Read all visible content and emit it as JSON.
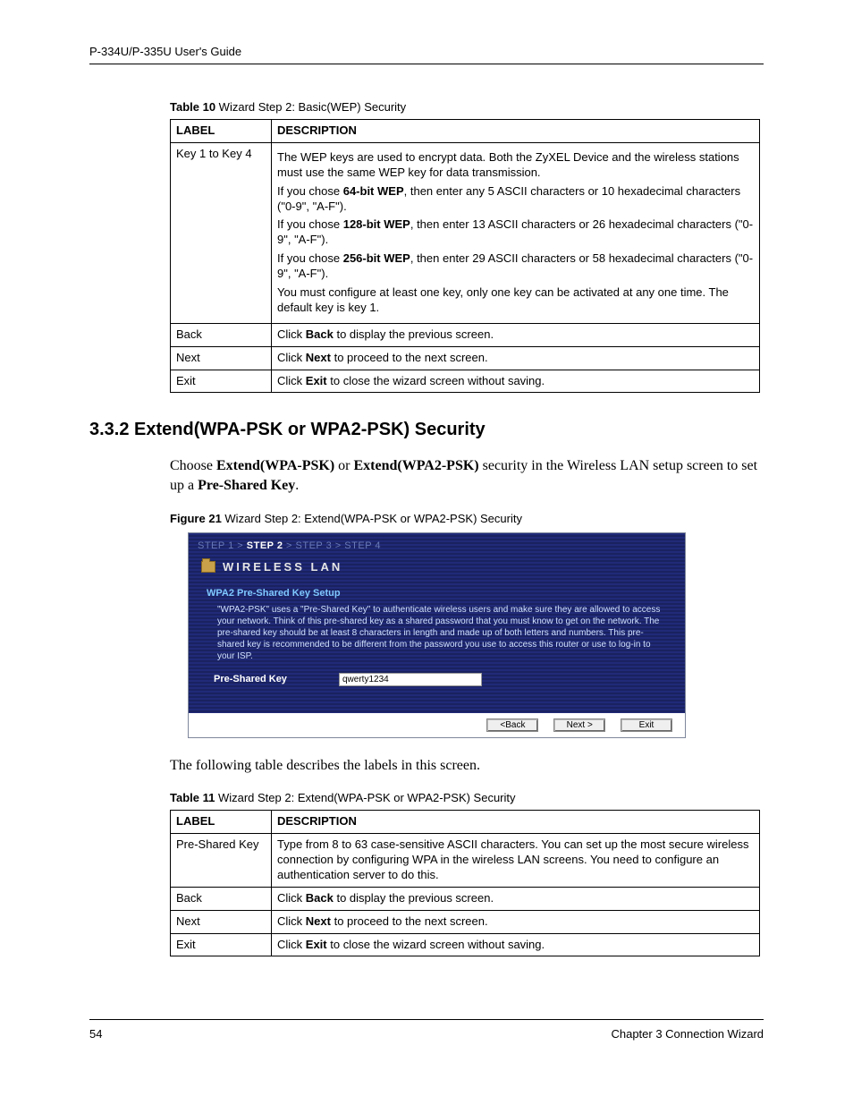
{
  "header": {
    "guide_title": "P-334U/P-335U User's Guide"
  },
  "table10": {
    "caption_prefix": "Table 10",
    "caption_rest": "   Wizard Step 2: Basic(WEP) Security",
    "col_label": "LABEL",
    "col_desc": "DESCRIPTION",
    "rows": [
      {
        "label": "Key 1 to Key 4",
        "desc_parts": {
          "p1": "The WEP keys are used to encrypt data. Both the ZyXEL Device and the wireless stations must use the same WEP key for data transmission.",
          "p2a": "If you chose ",
          "p2b": "64-bit WEP",
          "p2c": ", then enter any 5 ASCII characters or 10 hexadecimal characters (\"0-9\", \"A-F\").",
          "p3a": "If you chose ",
          "p3b": "128-bit WEP",
          "p3c": ", then enter 13 ASCII characters or 26 hexadecimal characters   (\"0-9\", \"A-F\").",
          "p4a": "If you chose ",
          "p4b": "256-bit WEP",
          "p4c": ", then enter 29 ASCII characters or 58 hexadecimal characters   (\"0-9\", \"A-F\").",
          "p5": "You must configure at least one key, only one key can be activated at any one time. The default key is key 1."
        }
      },
      {
        "label": "Back",
        "desc_parts": {
          "a": "Click ",
          "b": "Back",
          "c": " to display the previous screen."
        }
      },
      {
        "label": "Next",
        "desc_parts": {
          "a": "Click ",
          "b": "Next",
          "c": " to proceed to the next screen."
        }
      },
      {
        "label": "Exit",
        "desc_parts": {
          "a": "Click ",
          "b": "Exit",
          "c": " to close the wizard screen without saving."
        }
      }
    ]
  },
  "section_heading": "3.3.2  Extend(WPA-PSK or WPA2-PSK) Security",
  "body_para_parts": {
    "a": "Choose ",
    "b": "Extend(WPA-PSK)",
    "c": " or ",
    "d": "Extend(WPA2-PSK)",
    "e": " security in the Wireless LAN setup screen to set up a ",
    "f": "Pre-Shared Key",
    "g": "."
  },
  "figure21": {
    "caption_prefix": "Figure 21",
    "caption_rest": "   Wizard Step 2: Extend(WPA-PSK or WPA2-PSK) Security",
    "wizard": {
      "steps": {
        "s1": "STEP 1",
        "sep": " > ",
        "s2": "STEP 2",
        "s3": "STEP 3",
        "s4": "STEP 4"
      },
      "title": "WIRELESS LAN",
      "subtitle": "WPA2 Pre-Shared Key Setup",
      "desc": "\"WPA2-PSK\" uses a \"Pre-Shared Key\" to authenticate wireless users and make sure they are allowed to access your network. Think of this pre-shared key as a shared password that you must know to get on the network. The pre-shared key should be at least 8 characters in length and made up of both letters and numbers. This pre-shared key is recommended to be different from the password you use to access this router or use to log-in to your ISP.",
      "field_label": "Pre-Shared Key",
      "field_value": "qwerty1234",
      "btn_back": "<Back",
      "btn_next": "Next >",
      "btn_exit": "Exit"
    }
  },
  "body_para2": "The following table describes the labels in this screen.",
  "table11": {
    "caption_prefix": "Table 11",
    "caption_rest": "   Wizard Step 2: Extend(WPA-PSK or WPA2-PSK) Security",
    "col_label": "LABEL",
    "col_desc": "DESCRIPTION",
    "rows": [
      {
        "label": "Pre-Shared Key",
        "desc": "Type from 8 to 63 case-sensitive ASCII characters. You can set up the most secure wireless connection by configuring WPA in the wireless LAN screens. You need to configure an authentication server to do this."
      },
      {
        "label": "Back",
        "desc_parts": {
          "a": "Click ",
          "b": "Back",
          "c": " to display the previous screen."
        }
      },
      {
        "label": "Next",
        "desc_parts": {
          "a": "Click ",
          "b": "Next",
          "c": " to proceed to the next screen."
        }
      },
      {
        "label": "Exit",
        "desc_parts": {
          "a": "Click ",
          "b": "Exit",
          "c": " to close the wizard screen without saving."
        }
      }
    ]
  },
  "footer": {
    "page_number": "54",
    "chapter": "Chapter 3 Connection Wizard"
  }
}
